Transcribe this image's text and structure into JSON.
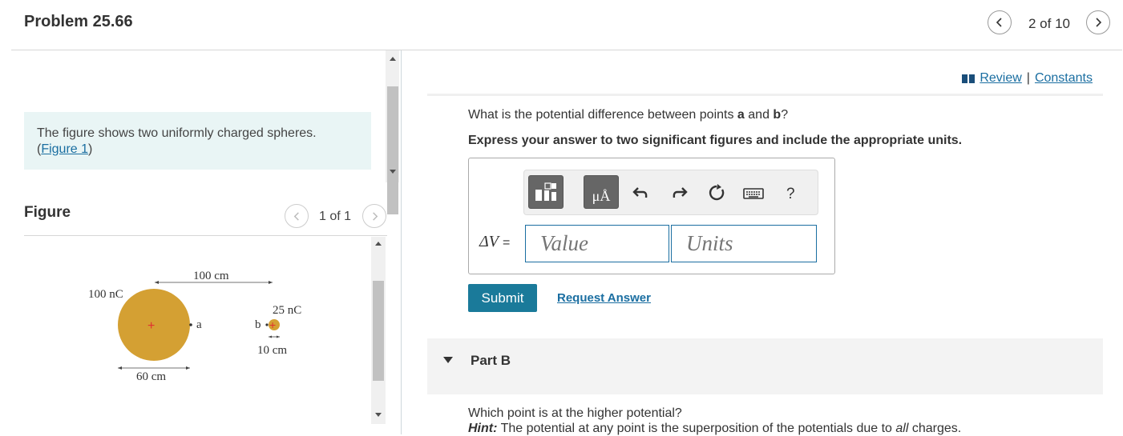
{
  "header": {
    "title": "Problem 25.66",
    "position": "2 of 10"
  },
  "left": {
    "intro_text": "The figure shows two uniformly charged spheres.",
    "intro_link": "Figure 1",
    "figure_title": "Figure",
    "figure_count": "1 of 1",
    "figure": {
      "big_charge": "100 nC",
      "small_charge": "25 nC",
      "distance": "100 cm",
      "big_diameter": "60 cm",
      "small_diameter": "10 cm",
      "point_a": "a",
      "point_b": "b",
      "sphere_color": "#d4a033",
      "plus_color": "#e03030"
    }
  },
  "right": {
    "review": "Review",
    "separator": "|",
    "constants": "Constants",
    "question": {
      "pre": "What is the potential difference between points ",
      "a": "a",
      "mid": " and ",
      "b": "b",
      "post": "?"
    },
    "instruction": "Express your answer to two significant figures and include the appropriate units.",
    "toolbar": {
      "units_btn": "μÅ",
      "help": "?"
    },
    "answer_label": "ΔV",
    "answer_eq": "=",
    "value_placeholder": "Value",
    "units_placeholder": "Units",
    "submit": "Submit",
    "request_answer": "Request Answer",
    "part_b": "Part B",
    "q2": "Which point is at the higher potential?",
    "hint_label": "Hint:",
    "hint_pre": " The potential at any point is the superposition of the potentials due to ",
    "hint_em": "all",
    "hint_post": " charges."
  },
  "colors": {
    "accent": "#1a6ea1",
    "submit_bg": "#1a7a9a",
    "intro_bg": "#e9f5f5"
  }
}
